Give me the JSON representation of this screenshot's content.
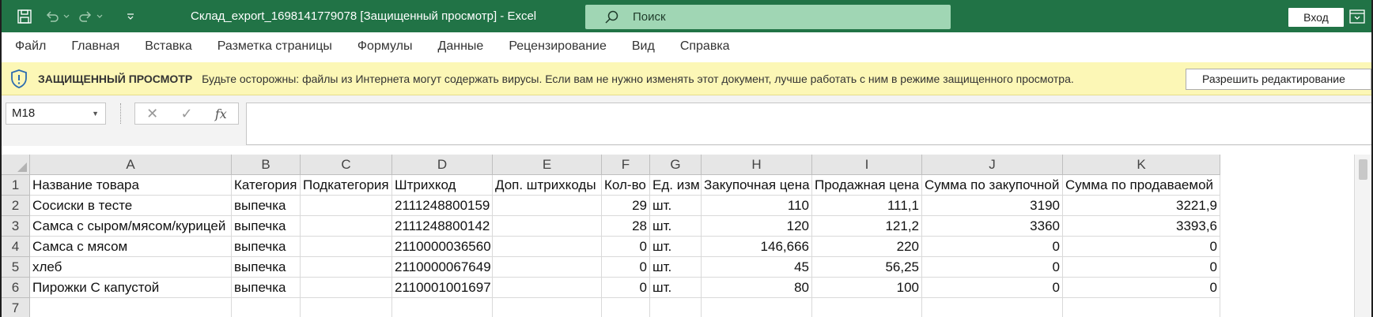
{
  "titlebar": {
    "title": "Склад_export_1698141779078  [Защищенный просмотр]  -  Excel",
    "search_placeholder": "Поиск",
    "signin_label": "Вход"
  },
  "ribbon": {
    "tabs": [
      "Файл",
      "Главная",
      "Вставка",
      "Разметка страницы",
      "Формулы",
      "Данные",
      "Рецензирование",
      "Вид",
      "Справка"
    ]
  },
  "protected_view": {
    "title": "ЗАЩИЩЕННЫЙ ПРОСМОТР",
    "message": "Будьте осторожны: файлы из Интернета могут содержать вирусы. Если вам не нужно изменять этот документ, лучше работать с ним в режиме защищенного просмотра.",
    "enable_button": "Разрешить редактирование"
  },
  "formula_bar": {
    "name_box": "M18",
    "fx_label": "fx",
    "formula_value": ""
  },
  "sheet": {
    "columns": [
      "A",
      "B",
      "C",
      "D",
      "E",
      "F",
      "G",
      "H",
      "I",
      "J",
      "K"
    ],
    "row_numbers": [
      "1",
      "2",
      "3",
      "4",
      "5",
      "6",
      "7"
    ],
    "rows": [
      [
        "Название товара",
        "Категория",
        "Подкатегория",
        "Штрихкод",
        "Доп. штрихкоды",
        "Кол-во",
        "Ед. изм",
        "Закупочная цена",
        "Продажная цена",
        "Сумма по закупочной",
        "Сумма по продаваемой"
      ],
      [
        "Сосиски в тесте",
        "выпечка",
        "",
        "2111248800159",
        "",
        "29",
        "шт.",
        "110",
        "111,1",
        "3190",
        "3221,9"
      ],
      [
        "Самса с сыром/мясом/курицей",
        "выпечка",
        "",
        "2111248800142",
        "",
        "28",
        "шт.",
        "120",
        "121,2",
        "3360",
        "3393,6"
      ],
      [
        "Самса с мясом",
        "выпечка",
        "",
        "2110000036560",
        "",
        "0",
        "шт.",
        "146,666",
        "220",
        "0",
        "0"
      ],
      [
        "хлеб",
        "выпечка",
        "",
        "2110000067649",
        "",
        "0",
        "шт.",
        "45",
        "56,25",
        "0",
        "0"
      ],
      [
        "Пирожки С капустой",
        "выпечка",
        "",
        "2110001001697",
        "",
        "0",
        "шт.",
        "80",
        "100",
        "0",
        "0"
      ],
      [
        "",
        "",
        "",
        "",
        "",
        "",
        "",
        "",
        "",
        "",
        ""
      ]
    ]
  },
  "colors": {
    "title_bar": "#217346",
    "protected_bar": "#fcf7b6",
    "search_box": "#a0d6b4"
  }
}
